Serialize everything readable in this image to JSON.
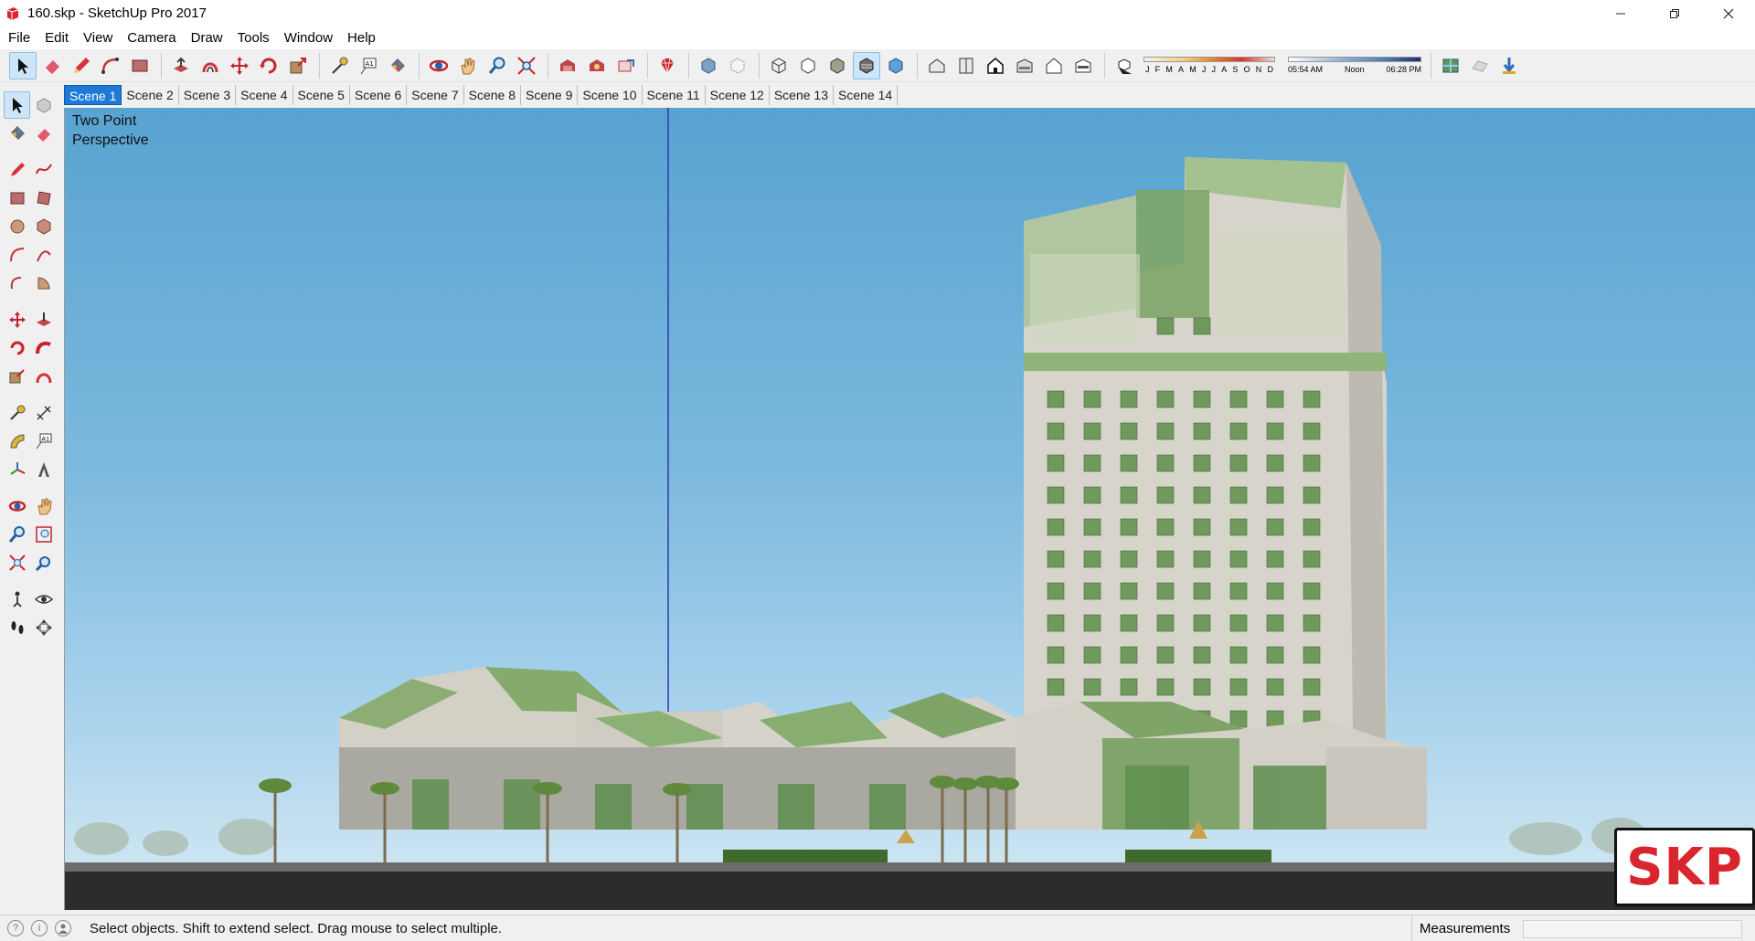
{
  "window": {
    "title": "160.skp - SketchUp Pro 2017",
    "minimize_icon": "minimize-icon",
    "maximize_icon": "restore-icon",
    "close_icon": "close-icon"
  },
  "menu": [
    "File",
    "Edit",
    "View",
    "Camera",
    "Draw",
    "Tools",
    "Window",
    "Help"
  ],
  "shadows": {
    "months": [
      "J",
      "F",
      "M",
      "A",
      "M",
      "J",
      "J",
      "A",
      "S",
      "O",
      "N",
      "D"
    ],
    "time_start": "05:54 AM",
    "time_mid": "Noon",
    "time_end": "06:28 PM"
  },
  "scenes": {
    "active_index": 0,
    "tabs": [
      "Scene 1",
      "Scene 2",
      "Scene 3",
      "Scene 4",
      "Scene 5",
      "Scene 6",
      "Scene 7",
      "Scene 8",
      "Scene 9",
      "Scene 10",
      "Scene 11",
      "Scene 12",
      "Scene 13",
      "Scene 14"
    ]
  },
  "viewport": {
    "camera_label_line1": "Two Point",
    "camera_label_line2": "Perspective",
    "watermark": "SKP"
  },
  "status": {
    "hint": "Select objects. Shift to extend select. Drag mouse to select multiple.",
    "measurements_label": "Measurements",
    "measurements_value": ""
  },
  "colors": {
    "sky_top": "#58a3d1",
    "facade": "#d9d6cf",
    "glass": "#7fa866",
    "active_tab": "#1e7ad6",
    "watermark_red": "#d8262e"
  }
}
